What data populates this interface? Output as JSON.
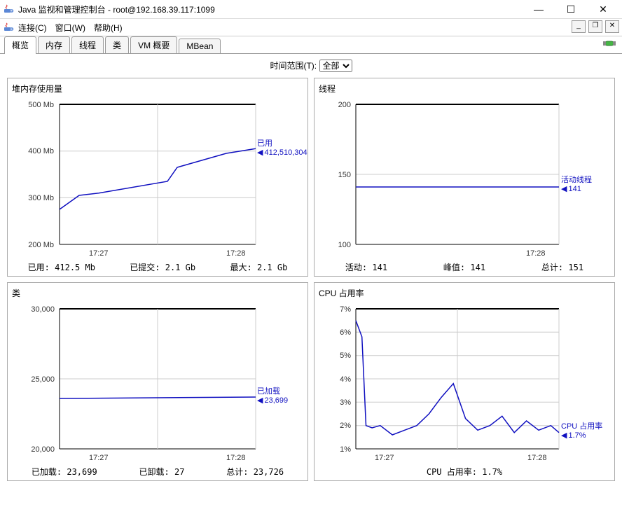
{
  "window": {
    "title": "Java 监视和管理控制台 - root@192.168.39.117:1099"
  },
  "menus": {
    "connect": "连接(C)",
    "window": "窗口(W)",
    "help": "帮助(H)"
  },
  "tabs": {
    "overview": "概览",
    "memory": "内存",
    "threads": "线程",
    "classes": "类",
    "vm": "VM 概要",
    "mbeans": "MBean"
  },
  "timeRange": {
    "label": "时间范围(T):",
    "selected": "全部",
    "options": [
      "全部"
    ]
  },
  "heap": {
    "title": "堆内存使用量",
    "callout": {
      "label": "已用",
      "value": "412,510,304"
    },
    "stats": {
      "usedLabel": "已用:",
      "usedValue": "412.5 Mb",
      "commitLabel": "已提交:",
      "commitValue": "2.1 Gb",
      "maxLabel": "最大:",
      "maxValue": "2.1 Gb"
    }
  },
  "threads": {
    "title": "线程",
    "callout": {
      "label": "活动线程",
      "value": "141"
    },
    "stats": {
      "liveLabel": "活动:",
      "liveValue": "141",
      "peakLabel": "峰值:",
      "peakValue": "141",
      "totalLabel": "总计:",
      "totalValue": "151"
    }
  },
  "classes": {
    "title": "类",
    "callout": {
      "label": "已加载",
      "value": "23,699"
    },
    "stats": {
      "loadedLabel": "已加载:",
      "loadedValue": "23,699",
      "unloadedLabel": "已卸载:",
      "unloadedValue": "27",
      "totalLabel": "总计:",
      "totalValue": "23,726"
    }
  },
  "cpu": {
    "title": "CPU 占用率",
    "callout": {
      "label": "CPU 占用率",
      "value": "1.7%"
    },
    "stats": {
      "label": "CPU 占用率:",
      "value": "1.7%"
    }
  },
  "chart_data": [
    {
      "type": "line",
      "title": "堆内存使用量",
      "ylabel": "Mb",
      "x_ticks": [
        "17:27",
        "17:28"
      ],
      "y_ticks": [
        200,
        300,
        400,
        500
      ],
      "ylim": [
        200,
        500
      ],
      "series": [
        {
          "name": "已用",
          "x": [
            0,
            0.1,
            0.2,
            0.55,
            0.6,
            0.85,
            1.0
          ],
          "y": [
            275,
            305,
            310,
            335,
            365,
            395,
            405
          ]
        }
      ]
    },
    {
      "type": "line",
      "title": "线程",
      "x_ticks": [
        "17:28"
      ],
      "y_ticks": [
        100,
        150,
        200
      ],
      "ylim": [
        100,
        200
      ],
      "series": [
        {
          "name": "活动线程",
          "x": [
            0,
            1
          ],
          "y": [
            141,
            141
          ]
        }
      ]
    },
    {
      "type": "line",
      "title": "类",
      "x_ticks": [
        "17:27",
        "17:28"
      ],
      "y_ticks": [
        20000,
        25000,
        30000
      ],
      "ylim": [
        20000,
        30000
      ],
      "series": [
        {
          "name": "已加载",
          "x": [
            0,
            1
          ],
          "y": [
            23600,
            23699
          ]
        }
      ]
    },
    {
      "type": "line",
      "title": "CPU 占用率",
      "ylabel": "%",
      "x_ticks": [
        "17:27",
        "17:28"
      ],
      "y_ticks": [
        1,
        2,
        3,
        4,
        5,
        6,
        7
      ],
      "ylim": [
        1,
        7
      ],
      "series": [
        {
          "name": "CPU 占用率",
          "x": [
            0,
            0.03,
            0.05,
            0.08,
            0.12,
            0.18,
            0.24,
            0.3,
            0.36,
            0.42,
            0.48,
            0.54,
            0.6,
            0.66,
            0.72,
            0.78,
            0.84,
            0.9,
            0.96,
            1.0
          ],
          "y": [
            6.5,
            5.8,
            2.0,
            1.9,
            2.0,
            1.6,
            1.8,
            2.0,
            2.5,
            3.2,
            3.8,
            2.3,
            1.8,
            2.0,
            2.4,
            1.7,
            2.2,
            1.8,
            2.0,
            1.7
          ]
        }
      ]
    }
  ]
}
